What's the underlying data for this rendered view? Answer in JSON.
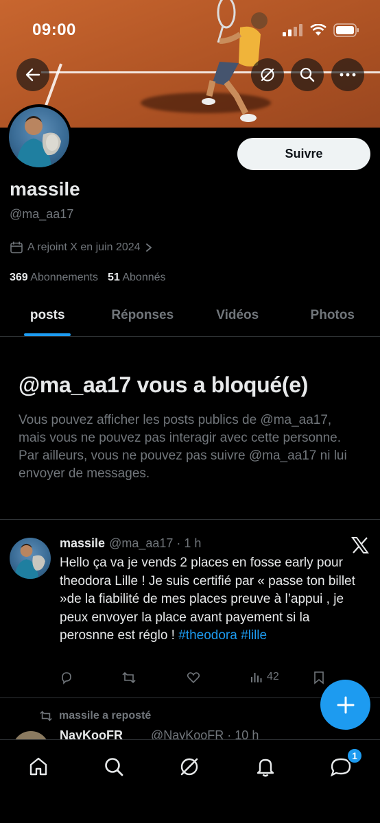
{
  "status_bar": {
    "time": "09:00"
  },
  "header": {
    "back_icon": "arrow-left-icon",
    "grok_icon": "grok-icon",
    "search_icon": "search-icon",
    "more_icon": "more-icon"
  },
  "profile": {
    "display_name": "massile",
    "handle": "@ma_aa17",
    "joined": "A rejoint X en juin 2024",
    "following_count": "369",
    "following_label": "Abonnements",
    "followers_count": "51",
    "followers_label": "Abonnés",
    "follow_button": "Suivre"
  },
  "tabs": [
    {
      "label": "posts",
      "active": true
    },
    {
      "label": "Réponses",
      "active": false
    },
    {
      "label": "Vidéos",
      "active": false
    },
    {
      "label": "Photos",
      "active": false
    }
  ],
  "blocked": {
    "title": "@ma_aa17 vous a bloqué(e)",
    "text": "Vous pouvez afficher les posts publics de @ma_aa17, mais vous ne pouvez pas interagir avec cette personne. Par ailleurs, vous ne pouvez pas suivre @ma_aa17 ni lui envoyer de messages."
  },
  "post": {
    "name": "massile",
    "meta": "@ma_aa17 · 1 h",
    "text": "Hello ça va je vends 2 places en fosse early pour theodora Lille ! Je suis certifié par « passe ton billet »de la fiabilité de mes places preuve à l’appui , je peux envoyer la place avant payement si la perosnne est réglo ! ",
    "hashtag1": "#theodora",
    "hashtag2": "#lille",
    "views": "42"
  },
  "next_post": {
    "reposted_label": "massile a reposté",
    "name": "NayKooFR",
    "meta": "@NayKooFR · 10 h"
  },
  "bottom_nav": {
    "items": [
      "home-icon",
      "search-icon",
      "grok-icon",
      "notifications-icon",
      "messages-icon"
    ],
    "messages_badge": "1"
  }
}
